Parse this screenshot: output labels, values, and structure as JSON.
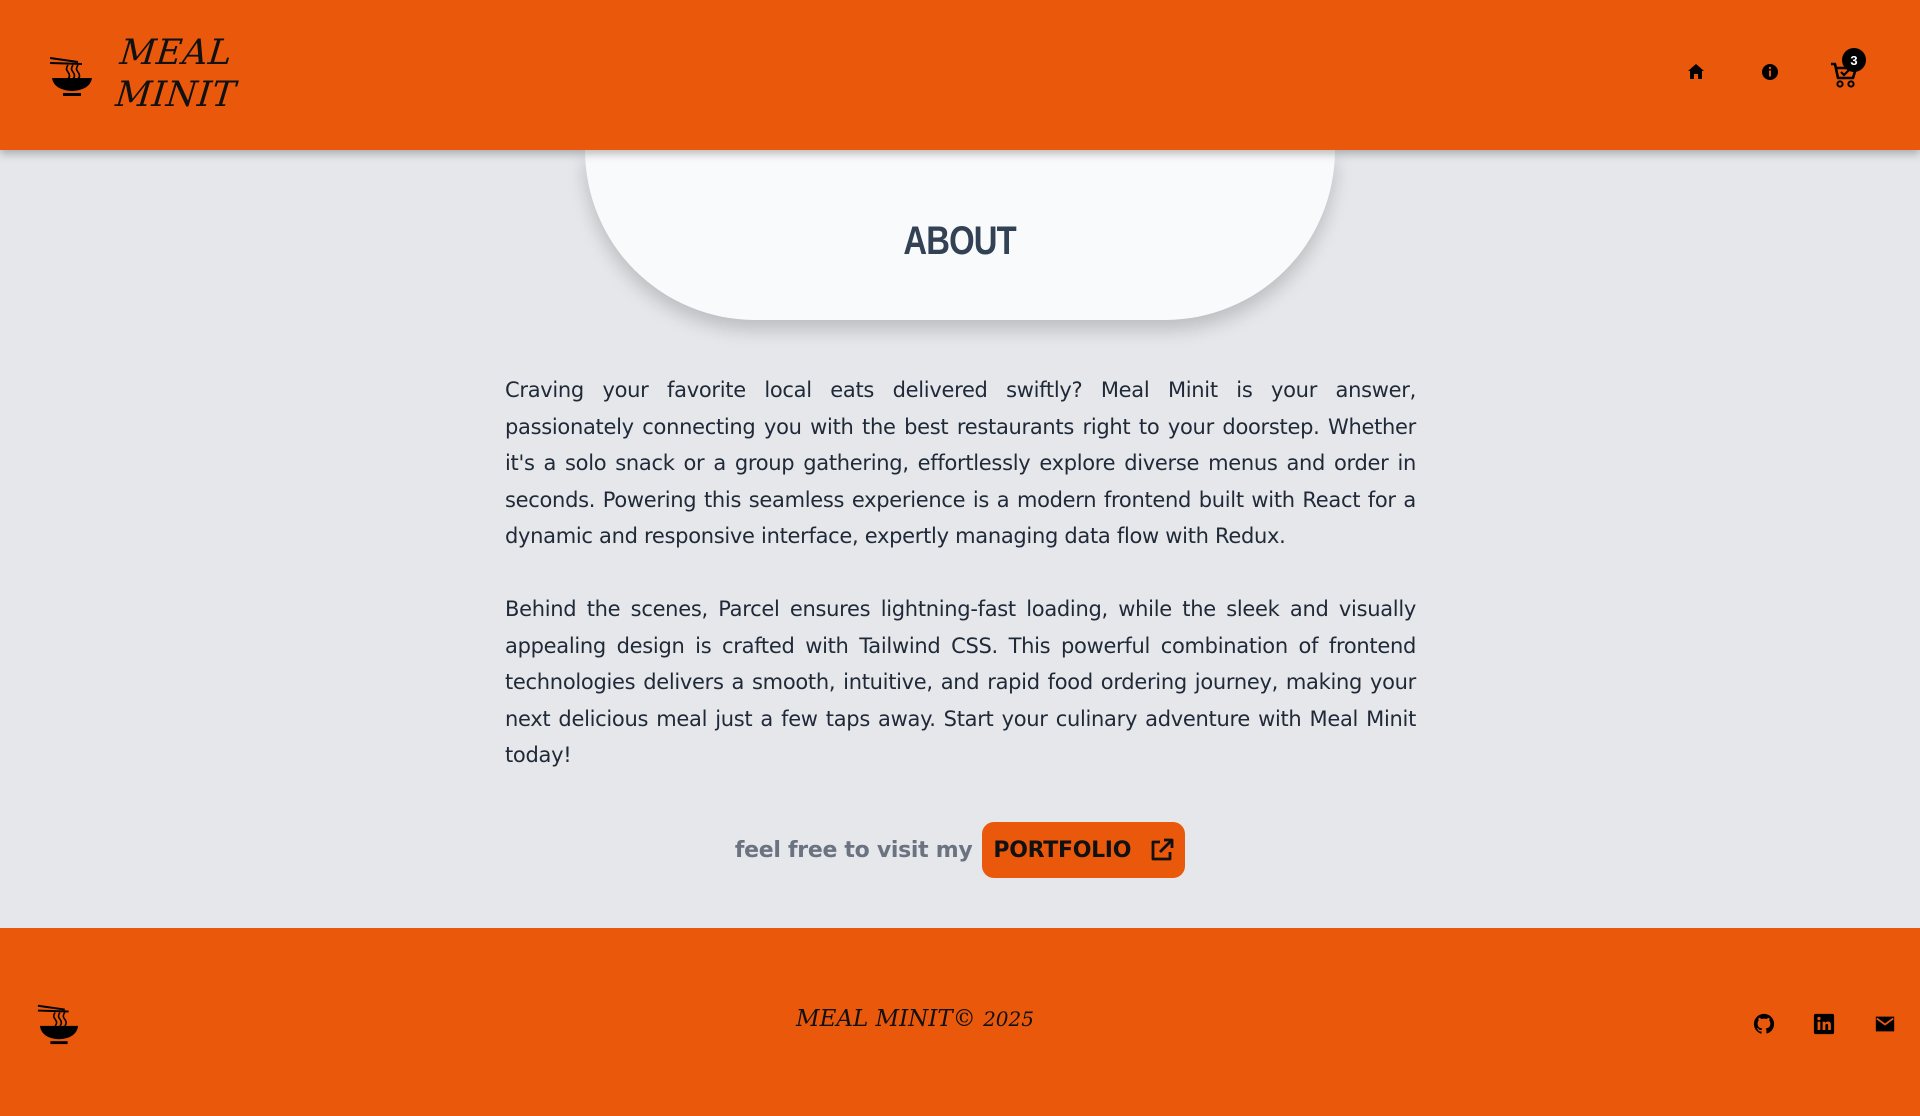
{
  "header": {
    "brand_line1": "MEAL",
    "brand_line2": "MINIT",
    "nav": {
      "home_icon": "home-icon",
      "info_icon": "info-icon",
      "cart_icon": "cart-icon",
      "cart_count": "3"
    }
  },
  "about": {
    "title": "ABOUT",
    "paragraphs": [
      "Craving your favorite local eats delivered swiftly? Meal Minit is your answer, passionately connecting you with the best restaurants right to your doorstep. Whether it's a solo snack or a group gathering, effortlessly explore diverse menus and order in seconds. Powering this seamless experience is a modern frontend built with React for a dynamic and responsive interface, expertly managing data flow with Redux.",
      "Behind the scenes, Parcel ensures lightning-fast loading, while the sleek and visually appealing design is crafted with Tailwind CSS. This powerful combination of frontend technologies delivers a smooth, intuitive, and rapid food ordering journey, making your next delicious meal just a few taps away. Start your culinary adventure with Meal Minit today!"
    ],
    "visit_text": "feel free to visit my",
    "portfolio_label": "PORTFOLIO"
  },
  "footer": {
    "brand": "MEAL MINIT",
    "copyright_symbol": "©",
    "year": "2025",
    "social_icons": [
      "github-icon",
      "linkedin-icon",
      "mail-icon"
    ]
  },
  "colors": {
    "brand_orange": "#ea580c",
    "page_background": "#e5e7eb",
    "card_background": "#f9fafb",
    "title_color": "#334155",
    "muted_text": "#6b7280"
  }
}
